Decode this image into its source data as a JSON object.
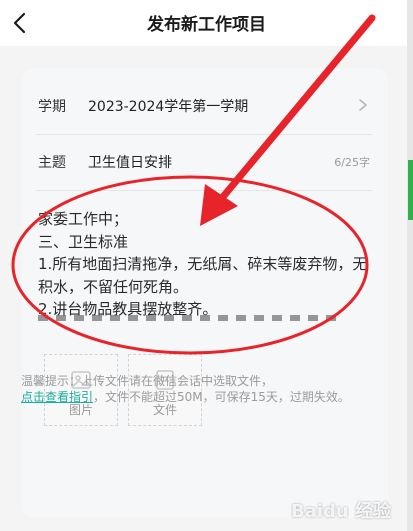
{
  "header": {
    "title": "发布新工作项目",
    "back_icon": "chevron-left-icon"
  },
  "form": {
    "term": {
      "label": "学期",
      "value": "2023-2024学年第一学期"
    },
    "subject": {
      "label": "主题",
      "value": "卫生值日安排",
      "count": "6/25字"
    },
    "content": "家委工作中；\n三、卫生标准\n1.所有地面扫清拖净，无纸屑、碎末等废弃物，无积水，不留任何死角。\n2.讲台物品教具摆放整齐。"
  },
  "upload": {
    "image_label": "图片",
    "file_label": "文件"
  },
  "tip": {
    "line1": "温馨提示：上传文件请在微信会话中选取文件，",
    "link": "点击查看指引",
    "line2": "，文件不能超过50M，可保存15天，过期失效。"
  },
  "colors": {
    "annotation": "#e8242b",
    "link": "#1aad9f"
  },
  "watermark": {
    "text": "Baidu 经验"
  }
}
